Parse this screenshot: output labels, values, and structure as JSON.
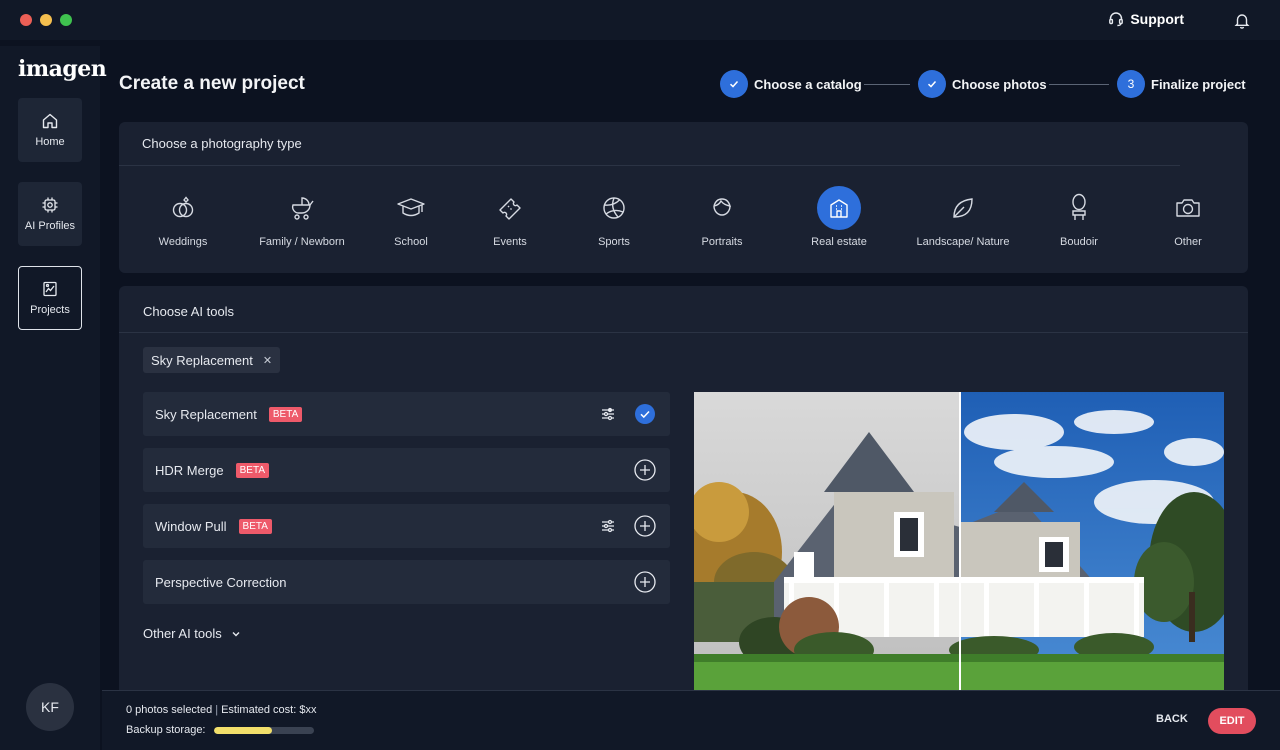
{
  "window": {
    "support_label": "Support"
  },
  "sidebar": {
    "logo": "imagen",
    "items": [
      {
        "label": "Home",
        "icon": "home-icon"
      },
      {
        "label": "AI Profiles",
        "icon": "chip-icon"
      },
      {
        "label": "Projects",
        "icon": "projects-icon",
        "active": true
      }
    ],
    "avatar_initials": "KF"
  },
  "header": {
    "title": "Create a new project",
    "steps": [
      {
        "label": "Choose a catalog",
        "state": "done"
      },
      {
        "label": "Choose photos",
        "state": "done"
      },
      {
        "label": "Finalize project",
        "state": "current",
        "number": "3"
      }
    ]
  },
  "photography": {
    "title": "Choose a photography type",
    "types": [
      {
        "label": "Weddings",
        "icon": "rings-icon"
      },
      {
        "label": "Family / Newborn",
        "icon": "stroller-icon"
      },
      {
        "label": "School",
        "icon": "graduation-cap-icon"
      },
      {
        "label": "Events",
        "icon": "ticket-icon"
      },
      {
        "label": "Sports",
        "icon": "ball-icon"
      },
      {
        "label": "Portraits",
        "icon": "portrait-icon"
      },
      {
        "label": "Real estate",
        "icon": "building-icon",
        "selected": true
      },
      {
        "label": "Landscape/ Nature",
        "icon": "leaf-icon"
      },
      {
        "label": "Boudoir",
        "icon": "mirror-icon"
      },
      {
        "label": "Other",
        "icon": "camera-icon"
      }
    ]
  },
  "ai_tools": {
    "title": "Choose AI tools",
    "selected_chip": "Sky Replacement",
    "tools": [
      {
        "name": "Sky Replacement",
        "badge": "BETA",
        "has_settings": true,
        "added": true
      },
      {
        "name": "HDR Merge",
        "badge": "BETA",
        "has_settings": false,
        "added": false
      },
      {
        "name": "Window Pull",
        "badge": "BETA",
        "has_settings": true,
        "added": false
      },
      {
        "name": "Perspective Correction",
        "badge": "",
        "has_settings": false,
        "added": false
      }
    ],
    "other_label": "Other AI tools"
  },
  "footer": {
    "photos_selected": "0 photos selected",
    "estimated_cost": "Estimated cost: $xx",
    "backup_label": "Backup storage:",
    "backup_fraction": 0.58,
    "back_label": "BACK",
    "edit_label": "EDIT"
  },
  "colors": {
    "accent": "#2e6fdb",
    "beta": "#ee5a6a",
    "edit": "#e24d5e",
    "storage": "#f2df6b"
  }
}
